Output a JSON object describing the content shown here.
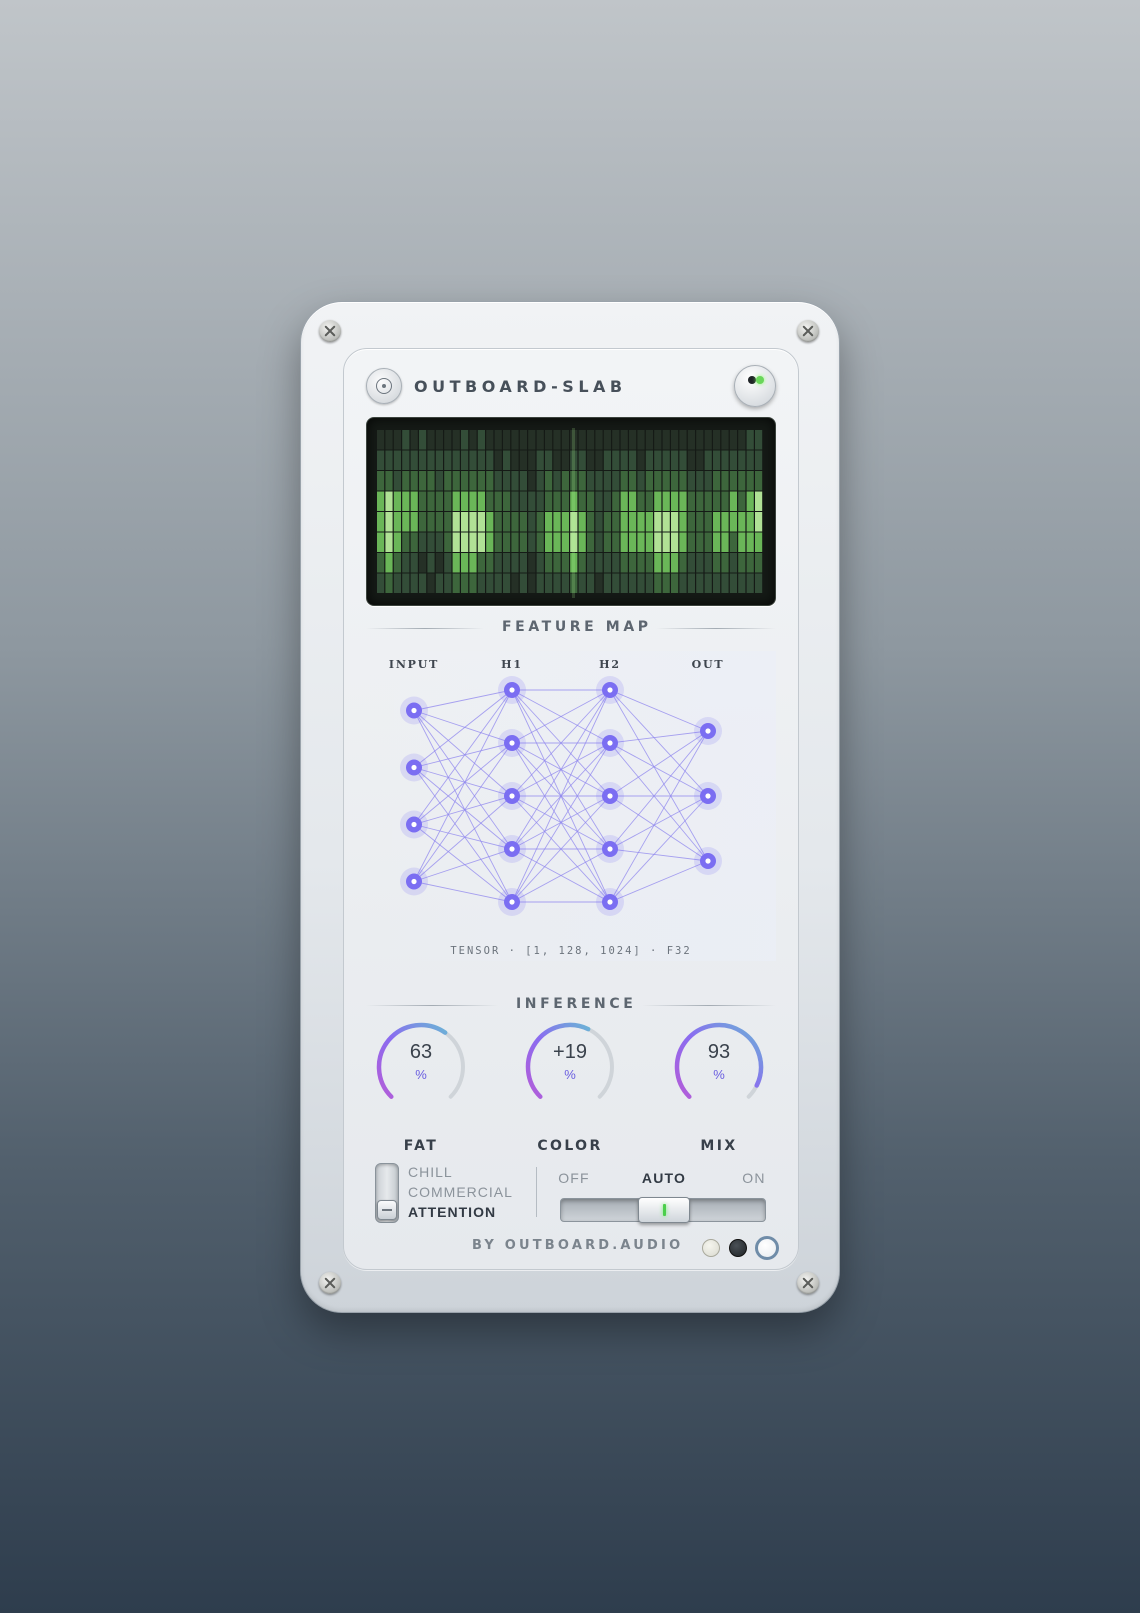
{
  "app": {
    "title": "OUTBOARD-SLAB",
    "power_led": "on"
  },
  "display": {
    "section_label": "FEATURE MAP",
    "columns": 46,
    "rows": 8,
    "colors": {
      "bg": "#151a16",
      "dim": "#2c3b2d",
      "mid": "#3f6a3e",
      "bright": "#6fbf5c",
      "hot": "#b8ec9c"
    },
    "heights": [
      4,
      4,
      4,
      3,
      4,
      2,
      3,
      4,
      4,
      3,
      4,
      4,
      2,
      2,
      3,
      3,
      2,
      2,
      1,
      2,
      3,
      2,
      3,
      4,
      3,
      4,
      4,
      3,
      2,
      3,
      1,
      2,
      3,
      3,
      4,
      4,
      3,
      2,
      2,
      3,
      4,
      5,
      3,
      4,
      5,
      5
    ],
    "cells": [
      [
        0,
        1,
        2,
        3,
        3,
        3,
        2,
        1
      ],
      [
        0,
        1,
        2,
        4,
        4,
        4,
        3,
        2
      ],
      [
        0,
        1,
        1,
        3,
        3,
        3,
        2,
        1
      ],
      [
        1,
        1,
        2,
        3,
        3,
        2,
        1,
        1
      ],
      [
        0,
        1,
        2,
        3,
        3,
        2,
        1,
        1
      ],
      [
        1,
        1,
        2,
        2,
        2,
        1,
        0,
        1
      ],
      [
        0,
        1,
        2,
        2,
        2,
        1,
        1,
        0
      ],
      [
        0,
        1,
        1,
        2,
        2,
        1,
        0,
        1
      ],
      [
        0,
        1,
        2,
        2,
        2,
        2,
        1,
        1
      ],
      [
        0,
        1,
        2,
        3,
        4,
        4,
        3,
        2
      ],
      [
        1,
        1,
        2,
        3,
        4,
        4,
        3,
        2
      ],
      [
        0,
        1,
        2,
        3,
        4,
        4,
        3,
        2
      ],
      [
        1,
        1,
        2,
        3,
        4,
        4,
        2,
        1
      ],
      [
        0,
        1,
        2,
        2,
        3,
        3,
        2,
        1
      ],
      [
        0,
        0,
        1,
        2,
        2,
        2,
        1,
        1
      ],
      [
        0,
        1,
        1,
        2,
        2,
        2,
        1,
        1
      ],
      [
        0,
        0,
        1,
        1,
        2,
        2,
        1,
        0
      ],
      [
        0,
        0,
        1,
        1,
        2,
        2,
        1,
        1
      ],
      [
        0,
        0,
        0,
        1,
        1,
        1,
        0,
        0
      ],
      [
        0,
        1,
        1,
        1,
        2,
        2,
        1,
        1
      ],
      [
        0,
        1,
        2,
        2,
        3,
        3,
        2,
        1
      ],
      [
        0,
        0,
        1,
        2,
        3,
        3,
        2,
        1
      ],
      [
        0,
        0,
        2,
        2,
        3,
        3,
        2,
        1
      ],
      [
        0,
        1,
        2,
        3,
        4,
        4,
        3,
        2
      ],
      [
        0,
        1,
        2,
        2,
        3,
        3,
        2,
        1
      ],
      [
        0,
        0,
        1,
        2,
        2,
        2,
        1,
        1
      ],
      [
        0,
        0,
        1,
        1,
        1,
        1,
        1,
        0
      ],
      [
        0,
        1,
        1,
        1,
        2,
        2,
        1,
        1
      ],
      [
        0,
        1,
        1,
        2,
        2,
        2,
        1,
        1
      ],
      [
        0,
        1,
        2,
        3,
        3,
        3,
        2,
        1
      ],
      [
        0,
        1,
        2,
        3,
        3,
        3,
        2,
        1
      ],
      [
        0,
        0,
        1,
        2,
        3,
        3,
        2,
        1
      ],
      [
        0,
        1,
        2,
        2,
        3,
        3,
        2,
        1
      ],
      [
        0,
        1,
        2,
        3,
        4,
        4,
        3,
        2
      ],
      [
        0,
        1,
        2,
        3,
        4,
        4,
        3,
        2
      ],
      [
        0,
        1,
        2,
        3,
        4,
        4,
        3,
        2
      ],
      [
        0,
        1,
        2,
        3,
        3,
        3,
        2,
        1
      ],
      [
        0,
        0,
        1,
        2,
        2,
        2,
        1,
        1
      ],
      [
        0,
        0,
        1,
        2,
        2,
        2,
        1,
        1
      ],
      [
        0,
        1,
        1,
        2,
        2,
        2,
        1,
        1
      ],
      [
        0,
        1,
        2,
        2,
        3,
        3,
        2,
        1
      ],
      [
        0,
        1,
        2,
        2,
        3,
        3,
        2,
        1
      ],
      [
        0,
        1,
        2,
        3,
        3,
        2,
        1,
        1
      ],
      [
        0,
        1,
        2,
        2,
        3,
        3,
        2,
        1
      ],
      [
        1,
        1,
        2,
        3,
        3,
        3,
        2,
        1
      ],
      [
        1,
        1,
        2,
        4,
        4,
        3,
        2,
        1
      ]
    ]
  },
  "network": {
    "layers": [
      {
        "label": "INPUT",
        "nodes": 4
      },
      {
        "label": "H1",
        "nodes": 5
      },
      {
        "label": "H2",
        "nodes": 5
      },
      {
        "label": "OUT",
        "nodes": 3
      }
    ],
    "tensor_label": "TENSOR · [1, 128, 1024] · F32",
    "node_color": "#7b6ef2",
    "edge_color": "#8f86ee"
  },
  "inference": {
    "section_label": "INFERENCE",
    "knobs": [
      {
        "label": "FAT",
        "value": "63",
        "unit": "%",
        "level": 0.63
      },
      {
        "label": "COLOR",
        "value": "+19",
        "unit": "%",
        "level": 0.595
      },
      {
        "label": "MIX",
        "value": "93",
        "unit": "%",
        "level": 0.93
      }
    ],
    "gradient": [
      "#6bb3d6",
      "#8a6cf0",
      "#b45cd8"
    ]
  },
  "mode": {
    "options": [
      "CHILL",
      "COMMERCIAL",
      "ATTENTION"
    ],
    "selected": "ATTENTION"
  },
  "auto_switch": {
    "options": [
      "OFF",
      "AUTO",
      "ON"
    ],
    "selected": "AUTO"
  },
  "footer": {
    "brand": "BY OUTBOARD.AUDIO",
    "theme_dots": [
      "#d9d9cf",
      "#1f2326",
      "#e7ebef"
    ]
  }
}
